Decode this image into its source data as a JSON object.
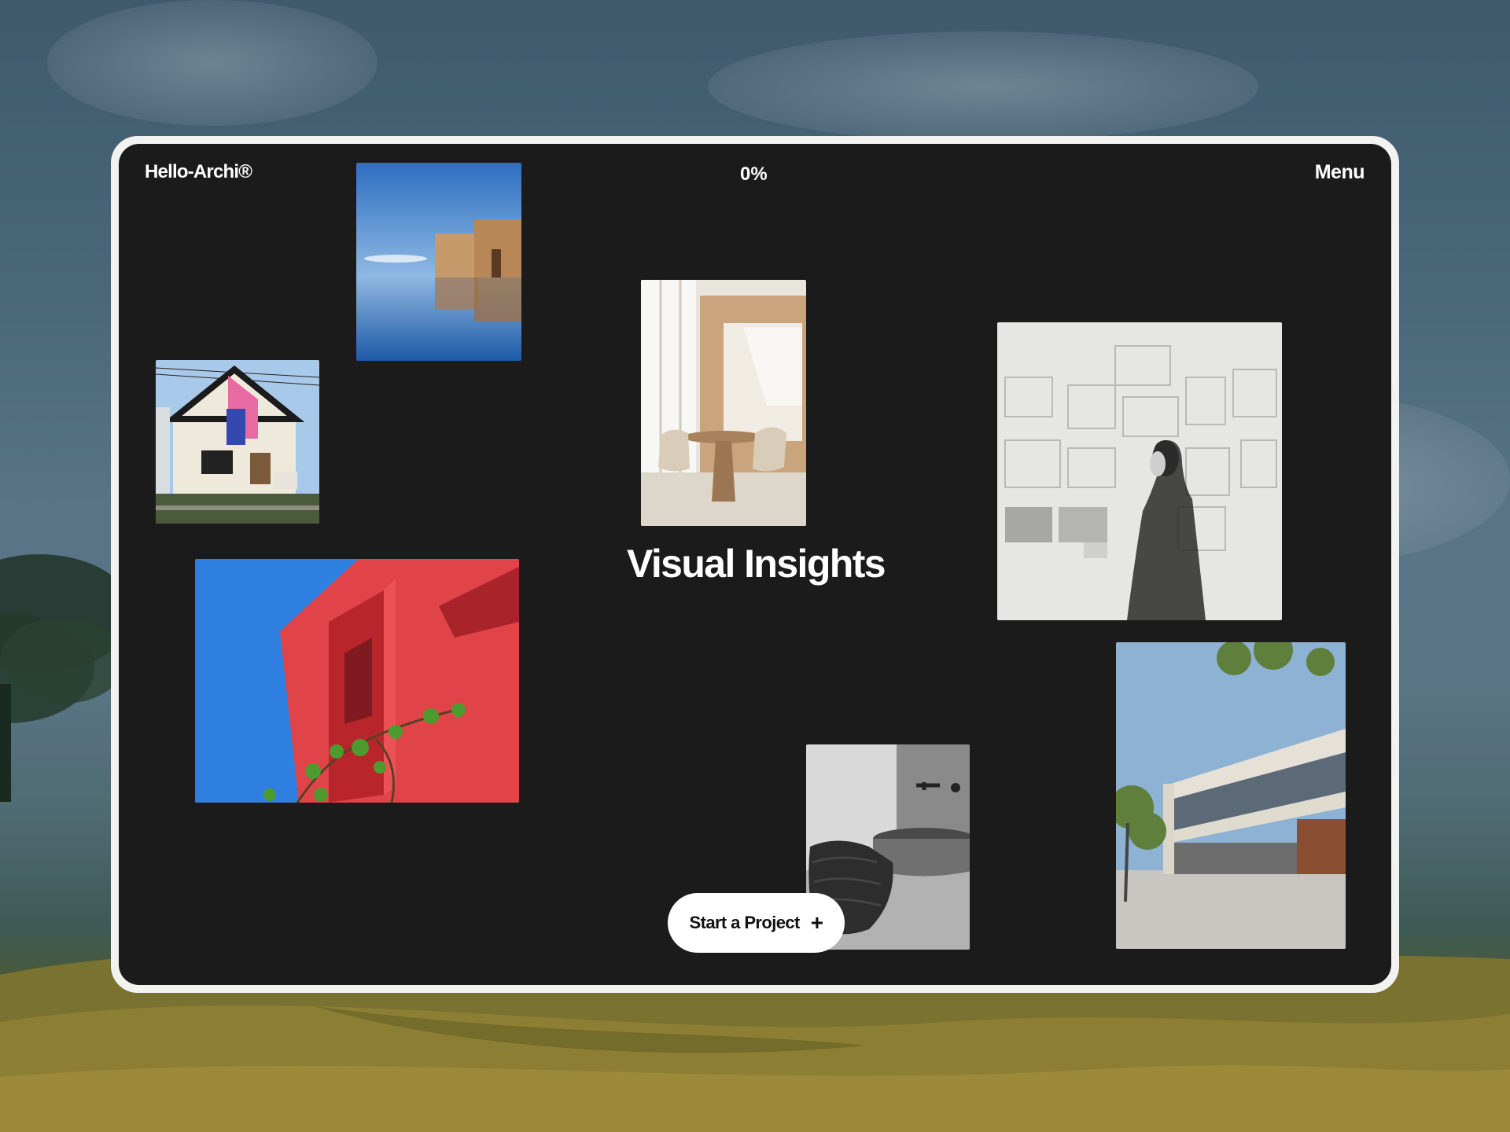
{
  "header": {
    "logo": "Hello-Archi®",
    "progress": "0%",
    "menu_label": "Menu"
  },
  "main": {
    "title": "Visual Insights"
  },
  "cta": {
    "label": "Start a Project",
    "icon": "plus-icon"
  },
  "gallery": {
    "images": [
      "reflection-building-photo",
      "pink-gable-house-photo",
      "dining-interior-photo",
      "architect-sketch-wall-photo",
      "red-facade-photo",
      "washbasin-towels-photo",
      "modern-villa-photo"
    ]
  },
  "colors": {
    "frame": "#f2f2f0",
    "screen_background": "#1b1b1b",
    "text": "#ffffff",
    "button_background": "#ffffff"
  }
}
